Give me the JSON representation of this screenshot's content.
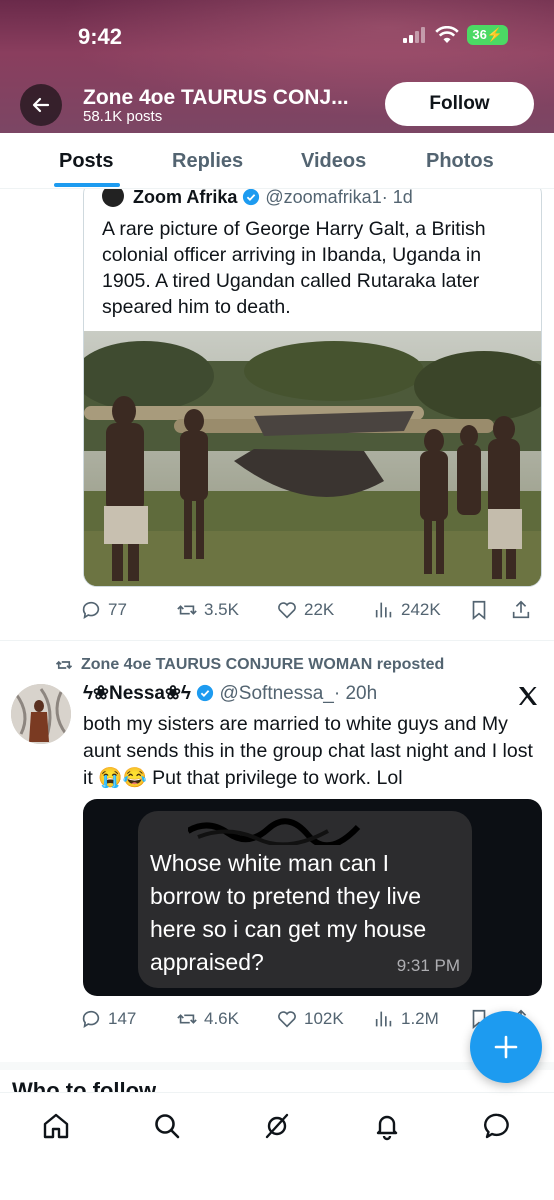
{
  "status_bar": {
    "time": "9:42",
    "battery": "36"
  },
  "profile": {
    "name": "Zone 4oe TAURUS CONJ...",
    "posts": "58.1K posts",
    "follow_label": "Follow"
  },
  "tabs": [
    {
      "label": "Posts",
      "active": true
    },
    {
      "label": "Replies",
      "active": false
    },
    {
      "label": "Videos",
      "active": false
    },
    {
      "label": "Photos",
      "active": false
    }
  ],
  "quote_tweet": {
    "name": "Zoom Afrika",
    "handle": "@zoomafrika1",
    "time": "· 1d",
    "text": "A rare picture of George Harry Galt, a British colonial officer arriving in Ibanda, Uganda in 1905. A tired Ugandan called Rutaraka later speared him to death."
  },
  "tweet1_actions": {
    "replies": "77",
    "reposts": "3.5K",
    "likes": "22K",
    "views": "242K"
  },
  "tweet2": {
    "repost_label": "Zone 4oe TAURUS CONJURE WOMAN reposted",
    "name": "ϟ❀Nessa❀ϟ",
    "handle": "@Softnessa_",
    "time": "· 20h",
    "text": "both my sisters are married to white guys and My aunt sends this in the group chat last night and I lost it 😭😂 Put that privilege to work. Lol",
    "media": {
      "message": "Whose white man can I borrow to pretend they live here so i can get my house appraised?",
      "time": "9:31 PM"
    }
  },
  "tweet2_actions": {
    "replies": "147",
    "reposts": "4.6K",
    "likes": "102K",
    "views": "1.2M"
  },
  "section_heading": "Who to follow",
  "colors": {
    "accent": "#1d9bf0",
    "text": "#0f1419",
    "muted": "#536471"
  }
}
